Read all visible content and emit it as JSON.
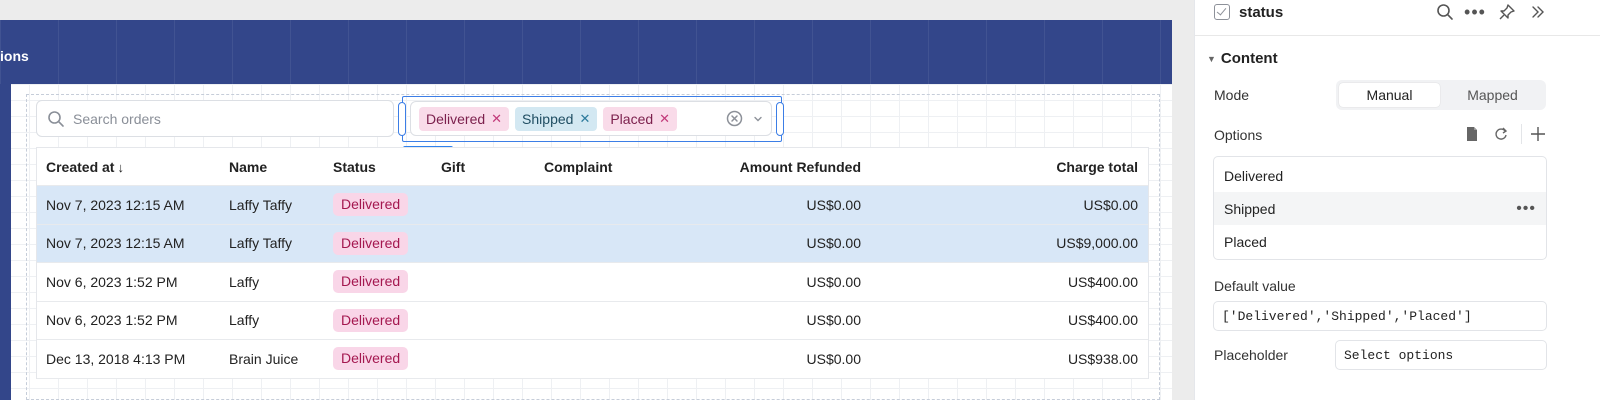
{
  "app": {
    "header_title_fragment": "ions"
  },
  "search": {
    "placeholder": "Search orders"
  },
  "multiselect": {
    "tags": [
      {
        "label": "Delivered"
      },
      {
        "label": "Shipped"
      },
      {
        "label": "Placed"
      }
    ],
    "component_label": "status"
  },
  "table": {
    "columns": [
      "Created at",
      "Name",
      "Status",
      "Gift",
      "Complaint",
      "Amount Refunded",
      "Charge total"
    ],
    "sort_indicator": "↓",
    "rows": [
      {
        "created": "Nov 7, 2023 12:15 AM",
        "name": "Laffy Taffy",
        "status": "Delivered",
        "gift": "",
        "complaint": "",
        "refunded": "US$0.00",
        "total": "US$0.00",
        "selected": true
      },
      {
        "created": "Nov 7, 2023 12:15 AM",
        "name": "Laffy Taffy",
        "status": "Delivered",
        "gift": "",
        "complaint": "",
        "refunded": "US$0.00",
        "total": "US$9,000.00",
        "selected": true
      },
      {
        "created": "Nov 6, 2023 1:52 PM",
        "name": "Laffy",
        "status": "Delivered",
        "gift": "",
        "complaint": "",
        "refunded": "US$0.00",
        "total": "US$400.00",
        "selected": false
      },
      {
        "created": "Nov 6, 2023 1:52 PM",
        "name": "Laffy",
        "status": "Delivered",
        "gift": "",
        "complaint": "",
        "refunded": "US$0.00",
        "total": "US$400.00",
        "selected": false
      },
      {
        "created": "Dec 13, 2018 4:13 PM",
        "name": "Brain Juice",
        "status": "Delivered",
        "gift": "",
        "complaint": "",
        "refunded": "US$0.00",
        "total": "US$938.00",
        "selected": false
      }
    ]
  },
  "panel": {
    "title": "status",
    "section": "Content",
    "mode_label": "Mode",
    "mode_options": [
      "Manual",
      "Mapped"
    ],
    "mode_selected": "Manual",
    "options_label": "Options",
    "options": [
      "Delivered",
      "Shipped",
      "Placed"
    ],
    "default_value_label": "Default value",
    "default_value": "['Delivered','Shipped','Placed']",
    "placeholder_label": "Placeholder",
    "placeholder_value": "Select options"
  },
  "colors": {
    "header_bg": "#33468a",
    "selection_blue": "#3c7ee6",
    "delivered_badge_bg": "#f9d6e8",
    "delivered_badge_fg": "#a4174f",
    "shipped_tag_bg": "#d3e8f2",
    "selected_row_bg": "#d8e7f7"
  }
}
